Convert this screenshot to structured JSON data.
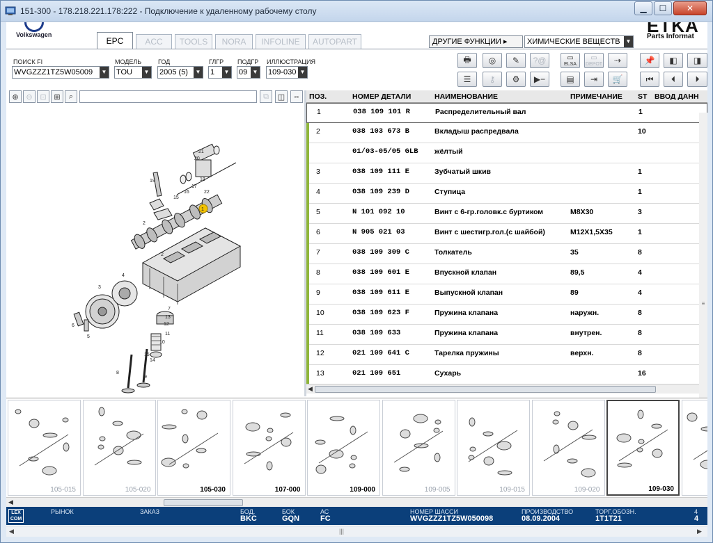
{
  "window": {
    "title": "151-300 - 178.218.221.178:222 - Подключение к удаленному рабочему столу",
    "controls": {
      "minimize": "▁",
      "maximize": "☐",
      "close": "✕"
    }
  },
  "brand": {
    "vw": "Volkswagen",
    "etka_big": "ETKA",
    "etka_small": "Parts Informat"
  },
  "tabs": [
    {
      "label": "EPC",
      "active": true
    },
    {
      "label": "ACC"
    },
    {
      "label": "TOOLS"
    },
    {
      "label": "NORA"
    },
    {
      "label": "INFOLINE"
    },
    {
      "label": "AUTOPART"
    }
  ],
  "functions": {
    "label": "ДРУГИЕ ФУНКЦИИ ▸",
    "selected": "ХИМИЧЕСКИЕ ВЕЩЕСТВ"
  },
  "filters": {
    "vin": {
      "label": "ПОИСК FI",
      "value": "WVGZZZ1TZ5W05009"
    },
    "model": {
      "label": "МОДЕЛЬ",
      "value": "TOU"
    },
    "year": {
      "label": "ГОД",
      "value": "2005 (5)"
    },
    "group": {
      "label": "ГЛГР",
      "value": "1"
    },
    "subgroup": {
      "label": "ПОДГР",
      "value": "09"
    },
    "illustration": {
      "label": "ИЛЛЮСТРАЦИЯ",
      "value": "109-030"
    }
  },
  "toolbar_labels": {
    "elsa": "ELSA",
    "depot": "DEPOT"
  },
  "table": {
    "headers": {
      "pos": "ПОЗ.",
      "num": "НОМЕР ДЕТАЛИ",
      "name": "НАИМЕНОВАНИЕ",
      "note": "ПРИМЕЧАНИЕ",
      "st": "ST",
      "entry": "ВВОД ДАНН"
    },
    "rows": [
      {
        "pos": "1",
        "num": "038 109 101 R",
        "name": "Распределительный вал",
        "note": "",
        "st": "1"
      },
      {
        "pos": "2",
        "num": "038 103 673 B",
        "name": "Вкладыш распредвала",
        "note": "",
        "st": "10"
      },
      {
        "pos": "",
        "num": "01/03-05/05 GLB",
        "name": "жёлтый",
        "note": "",
        "st": ""
      },
      {
        "pos": "3",
        "num": "038 109 111 E",
        "name": "Зубчатый шкив",
        "note": "",
        "st": "1"
      },
      {
        "pos": "4",
        "num": "038 109 239 D",
        "name": "Ступица",
        "note": "",
        "st": "1"
      },
      {
        "pos": "5",
        "num": "N   101 092 10",
        "name": "Винт с 6-гр.головк.с буртиком",
        "note": "M8X30",
        "st": "3"
      },
      {
        "pos": "6",
        "num": "N   905 021 03",
        "name": "Винт с шестигр.гол.(с шайбой)",
        "note": "M12X1,5X35",
        "st": "1"
      },
      {
        "pos": "7",
        "num": "038 109 309 C",
        "name": "Толкатель",
        "note": "35",
        "st": "8"
      },
      {
        "pos": "8",
        "num": "038 109 601 E",
        "name": "Впускной клапан",
        "note": "89,5",
        "st": "4"
      },
      {
        "pos": "9",
        "num": "038 109 611 E",
        "name": "Выпускной клапан",
        "note": "89",
        "st": "4"
      },
      {
        "pos": "10",
        "num": "038 109 623 F",
        "name": "Пружина клапана",
        "note": "наружн.",
        "st": "8"
      },
      {
        "pos": "11",
        "num": "038 109 633",
        "name": "Пружина клапана",
        "note": "внутрен.",
        "st": "8"
      },
      {
        "pos": "12",
        "num": "021 109 641 C",
        "name": "Тарелка пружины",
        "note": "верхн.",
        "st": "8"
      },
      {
        "pos": "13",
        "num": "021 109 651",
        "name": "Сухарь",
        "note": "",
        "st": "16"
      }
    ]
  },
  "illustration_callouts": [
    "21",
    "20",
    "19",
    "18",
    "17",
    "16",
    "15",
    "22",
    "1",
    "2",
    "2",
    "3",
    "4",
    "5",
    "6",
    "7",
    "8",
    "9",
    "10",
    "11",
    "12",
    "13",
    "14",
    "15"
  ],
  "thumbnails": [
    {
      "label": "105-015"
    },
    {
      "label": "105-020"
    },
    {
      "label": "105-030",
      "bold": true
    },
    {
      "label": "107-000",
      "bold": true
    },
    {
      "label": "109-000",
      "bold": true
    },
    {
      "label": "109-005"
    },
    {
      "label": "109-015"
    },
    {
      "label": "109-020"
    },
    {
      "label": "109-030",
      "bold": true,
      "selected": true
    },
    {
      "label": ""
    }
  ],
  "status": {
    "logo": "LEX COM",
    "market": {
      "label": "РЫНОК",
      "value": ""
    },
    "order": {
      "label": "ЗАКАЗ",
      "value": ""
    },
    "bod": {
      "label": "БОД.",
      "value": "BKC"
    },
    "bok": {
      "label": "БОК",
      "value": "GQN"
    },
    "ac": {
      "label": "АС",
      "value": "FC"
    },
    "chassis": {
      "label": "НОМЕР ШАССИ",
      "value": "WVGZZZ1TZ5W050098"
    },
    "production": {
      "label": "ПРОИЗВОДСТВО",
      "value": "08.09.2004"
    },
    "trade": {
      "label": "ТОРГ.ОБОЗН.",
      "value": "1T1T21"
    },
    "extra": {
      "label": "4",
      "value": "4"
    }
  }
}
